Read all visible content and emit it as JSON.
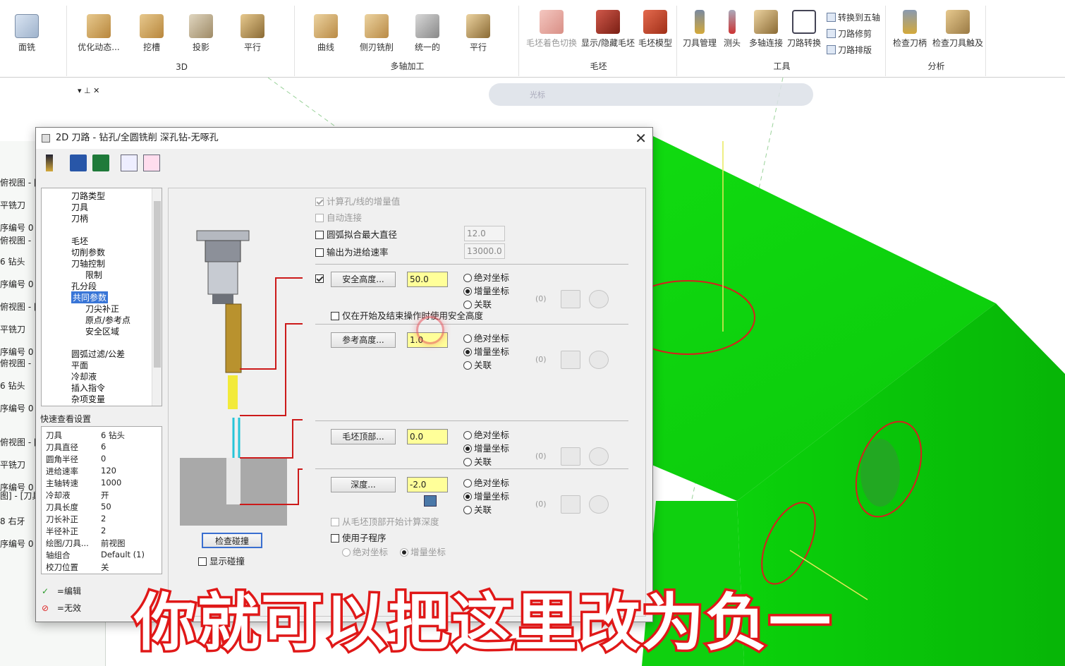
{
  "ribbon": {
    "items": {
      "face": "面铣",
      "optimize": "优化动态...",
      "pocket": "挖槽",
      "project": "投影",
      "parallel3d": "平行",
      "curve": "曲线",
      "flank": "侧刃铣削",
      "unified": "统一的",
      "parallel_ma": "平行",
      "stock_shade": "毛坯着色切换",
      "show_hide_stock": "显示/隐藏毛坯",
      "stock_model": "毛坯模型",
      "tool_manager": "刀具管理",
      "probe": "测头",
      "multiaxis_link": "多轴连接",
      "toolpath_transform": "刀路转换",
      "to_5axis": "转换到五轴",
      "toolpath_trim": "刀路修剪",
      "toolpath_nest": "刀路排版",
      "check_holder": "检查刀柄",
      "check_reach": "检查刀具触及"
    },
    "groups": {
      "g3d": "3D",
      "multiaxis": "多轴加工",
      "stock": "毛坯",
      "tools": "工具",
      "analysis": "分析"
    }
  },
  "cmdbar": {
    "cursor_label": "光标"
  },
  "leftpane": [
    "俯视图 - [",
    "平铣刀",
    "序编号 0",
    "俯视图 -",
    "6 钻头",
    "序编号 0",
    "俯视图 - [",
    "平铣刀",
    "序编号 0",
    "俯视图 -",
    "6 钻头",
    "序编号 0",
    "俯视图 - [",
    "平铣刀",
    "序编号 0",
    "图] - [刀具",
    "8 右牙",
    "序编号 0"
  ],
  "dialog": {
    "title": "2D 刀路 - 钻孔/全圆铣削 深孔钻-无啄孔",
    "tree": [
      "刀路类型",
      "刀具",
      "刀柄",
      "毛坯",
      "切削参数",
      "刀轴控制",
      "限制",
      "孔分段",
      "共同参数",
      "刀尖补正",
      "原点/参考点",
      "安全区域",
      "圆弧过滤/公差",
      "平面",
      "冷却液",
      "插入指令",
      "杂项变量"
    ],
    "quick_view_title": "快速查看设置",
    "quick_view": [
      {
        "k": "刀具",
        "v": "6 钻头"
      },
      {
        "k": "刀具直径",
        "v": "6"
      },
      {
        "k": "圆角半径",
        "v": "0"
      },
      {
        "k": "进给速率",
        "v": "120"
      },
      {
        "k": "主轴转速",
        "v": "1000"
      },
      {
        "k": "冷却液",
        "v": "开"
      },
      {
        "k": "刀具长度",
        "v": "50"
      },
      {
        "k": "刀长补正",
        "v": "2"
      },
      {
        "k": "半径补正",
        "v": "2"
      },
      {
        "k": "绘图/刀具...",
        "v": "前视图"
      },
      {
        "k": "轴组合",
        "v": "Default (1)"
      },
      {
        "k": "校刀位置",
        "v": "关"
      }
    ],
    "legend": {
      "edit": "=编辑",
      "invalid": "=无效"
    },
    "options": {
      "calc_increment": "计算孔/线的增量值",
      "auto_link": "自动连接",
      "arc_fit_max_dia": "圆弧拟合最大直径",
      "arc_fit_value": "12.0",
      "output_feed": "输出为进给速率",
      "output_feed_value": "13000.0",
      "clearance_only_start_end": "仅在开始及结束操作时使用安全高度",
      "from_stock_top": "从毛坯顶部开始计算深度",
      "use_subprogram": "使用子程序",
      "abs": "绝对坐标",
      "inc": "增量坐标"
    },
    "params": [
      {
        "button": "安全高度...",
        "value": "50.0"
      },
      {
        "button": "参考高度...",
        "value": "1.0"
      },
      {
        "button": "毛坯顶部...",
        "value": "0.0"
      },
      {
        "button": "深度...",
        "value": "-2.0"
      }
    ],
    "radio": {
      "abs": "绝对坐标",
      "inc": "增量坐标",
      "assoc": "关联",
      "zero": "(0)"
    },
    "check_collision": "检查碰撞",
    "show_collision": "显示碰撞",
    "footer_partial": "刀"
  },
  "subtitle": "你就可以把这里改为负一"
}
